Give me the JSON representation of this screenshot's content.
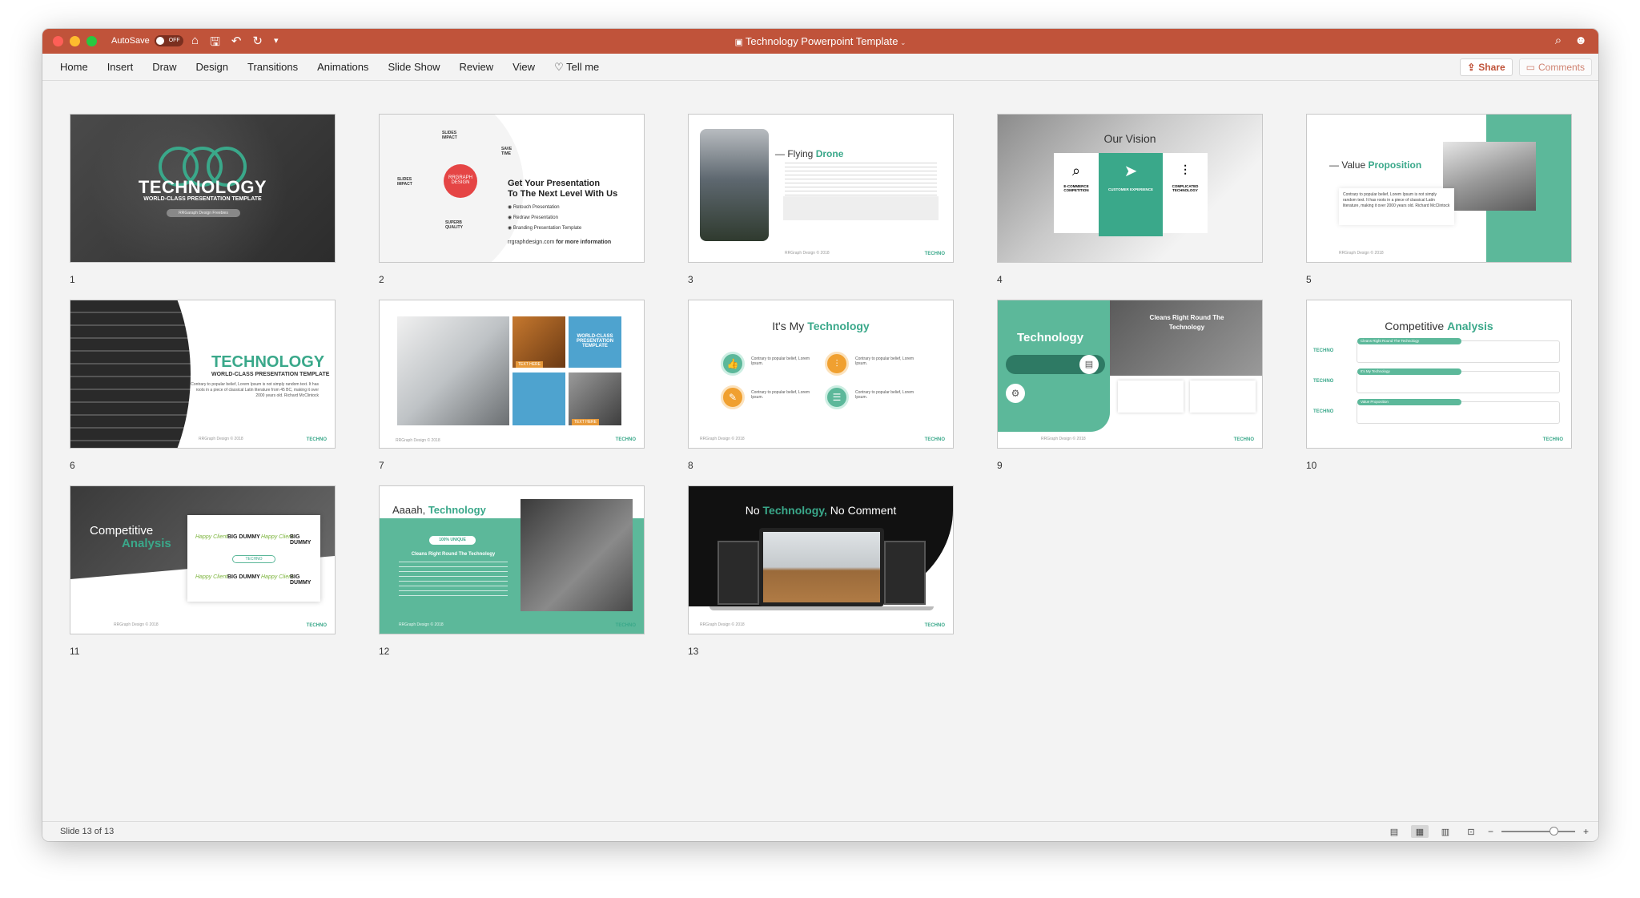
{
  "titlebar": {
    "autosave_label": "AutoSave",
    "autosave_state": "OFF",
    "document_title": "Technology Powerpoint Template"
  },
  "ribbon": {
    "tabs": [
      "Home",
      "Insert",
      "Draw",
      "Design",
      "Transitions",
      "Animations",
      "Slide Show",
      "Review",
      "View",
      "Tell me"
    ],
    "share_label": "Share",
    "comments_label": "Comments"
  },
  "slides": {
    "s1": {
      "number": "1",
      "title": "TECHNOLOGY",
      "subtitle": "WORLD-CLASS PRESENTATION TEMPLATE",
      "tag": "RRGaraph Design Freebies"
    },
    "s2": {
      "number": "2",
      "badge_line1": "RRGRAPH",
      "badge_line2": "DESIGN",
      "heading1": "Get Your Presentation",
      "heading2": "To The Next Level With Us",
      "items": [
        "Retouch Presentation",
        "Redraw Presentation",
        "Branding Presentation Template"
      ],
      "labels": [
        "SLIDES IMPACT",
        "SAVE TIME",
        "SLIDES IMPACT",
        "SUPERB QUALITY"
      ],
      "url": "rrgraphdesign.com",
      "url_suffix": "for more information"
    },
    "s3": {
      "number": "3",
      "title_a": "Flying",
      "title_b": "Drone",
      "footer": "RRGraph Design © 2018",
      "brand": "TECHNO"
    },
    "s4": {
      "number": "4",
      "title": "Our Vision",
      "cols": [
        "E-COMMERCE COMPETITION",
        "CUSTOMER EXPERIENCE",
        "COMPLICATED TECHNOLOGY"
      ]
    },
    "s5": {
      "number": "5",
      "title_a": "Value",
      "title_b": "Proposition",
      "body": "Contrary to popular belief, Lorem Ipsum is not simply random text. It has roots in a piece of classical Latin literature, making it over 2000 years old. Richard McClintock",
      "footer": "RRGraph Design © 2018"
    },
    "s6": {
      "number": "6",
      "title": "TECHNOLOGY",
      "subtitle": "WORLD-CLASS PRESENTATION TEMPLATE",
      "body": "Contrary to popular belief, Lorem Ipsum is not simply random text. It has roots in a piece of classical Latin literature from 45 BC, making it over 2000 years old. Richard McClintock",
      "footer": "RRGraph Design © 2018",
      "brand": "TECHNO"
    },
    "s7": {
      "number": "7",
      "box_title": "WORLD-CLASS PRESENTATION TEMPLATE",
      "text_here": "TEXT HERE",
      "footer": "RRGraph Design © 2018",
      "brand": "TECHNO"
    },
    "s8": {
      "number": "8",
      "title_a": "It's My",
      "title_b": "Technology",
      "items": [
        "Contrary to popular belief, Lorem Ipsum.",
        "Contrary to popular belief, Lorem Ipsum.",
        "Contrary to popular belief, Lorem Ipsum.",
        "Contrary to popular belief, Lorem Ipsum."
      ],
      "footer": "RRGraph Design © 2018",
      "brand": "TECHNO"
    },
    "s9": {
      "number": "9",
      "title": "Technology",
      "right_title": "Cleans Right Round The Technology",
      "footer": "RRGraph Design © 2018",
      "brand": "TECHNO"
    },
    "s10": {
      "number": "10",
      "title_a": "Competitive",
      "title_b": "Analysis",
      "rows": [
        "Cleans Right Round The Technology",
        "It's My Technology",
        "Value Proposition"
      ],
      "brand": "TECHNO"
    },
    "s11": {
      "number": "11",
      "title_a": "Competitive",
      "title_b": "Analysis",
      "logo_a": "Happy Client",
      "logo_b": "BIG DUMMY",
      "center": "TECHNO",
      "footer": "RRGraph Design © 2018",
      "brand": "TECHNO"
    },
    "s12": {
      "number": "12",
      "title_a": "Aaaah,",
      "title_b": "Technology",
      "pill": "100% UNIQUE",
      "subhead": "Cleans Right Round The Technology",
      "footer": "RRGraph Design © 2018",
      "brand": "TECHNO"
    },
    "s13": {
      "number": "13",
      "title_a": "No",
      "title_b": "Technology,",
      "title_c": "No Comment",
      "footer": "RRGraph Design © 2018",
      "brand": "TECHNO"
    }
  },
  "statusbar": {
    "slide_status": "Slide 13 of 13"
  },
  "colors": {
    "titlebar": "#c0533a",
    "accent_teal": "#3aa88a",
    "accent_red": "#e54545"
  }
}
